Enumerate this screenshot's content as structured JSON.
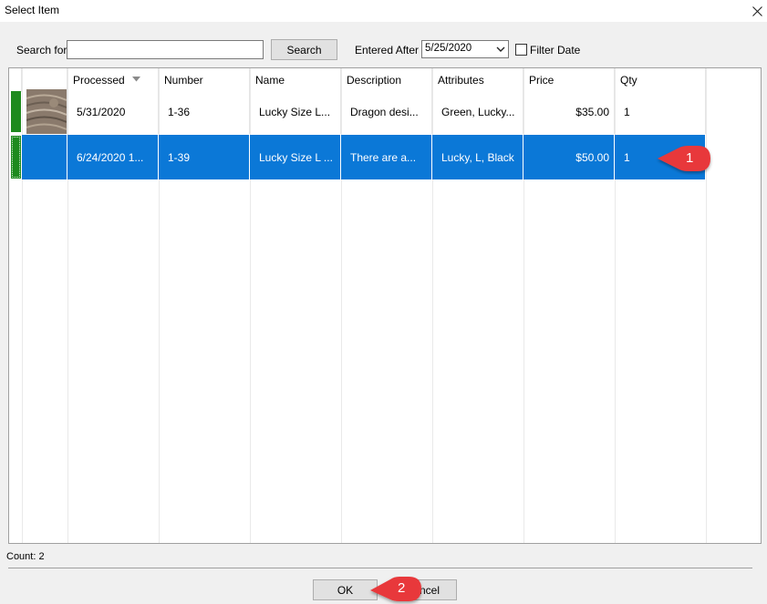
{
  "window": {
    "title": "Select Item"
  },
  "toolbar": {
    "search_label": "Search for",
    "search_value": "",
    "search_button": "Search",
    "entered_after_label": "Entered After",
    "entered_after_value": "5/25/2020",
    "filter_date_label": "Filter Date",
    "filter_date_checked": false
  },
  "table": {
    "columns": [
      "Processed",
      "Number",
      "Name",
      "Description",
      "Attributes",
      "Price",
      "Qty"
    ],
    "sort_column": "Processed",
    "rows": [
      {
        "processed": "5/31/2020",
        "number": "1-36",
        "name": "Lucky Size L...",
        "description": "Dragon desi...",
        "attributes": "Green, Lucky...",
        "price": "$35.00",
        "qty": "1",
        "status_color": "#1e8a1e",
        "selected": false,
        "has_thumbnail": true
      },
      {
        "processed": "6/24/2020 1...",
        "number": "1-39",
        "name": "Lucky Size L ...",
        "description": "There are a...",
        "attributes": "Lucky, L, Black",
        "price": "$50.00",
        "qty": "1",
        "status_color": "#1e8a1e",
        "selected": true,
        "has_thumbnail": false
      }
    ]
  },
  "status": {
    "count": "Count: 2"
  },
  "footer": {
    "ok_label": "OK",
    "cancel_label": "Cancel",
    "cancel_visible_text": "ncel"
  },
  "callouts": [
    "1",
    "2"
  ],
  "colors": {
    "selection": "#0b78d7",
    "callout": "#e8383a",
    "status_green": "#1e8a1e"
  }
}
